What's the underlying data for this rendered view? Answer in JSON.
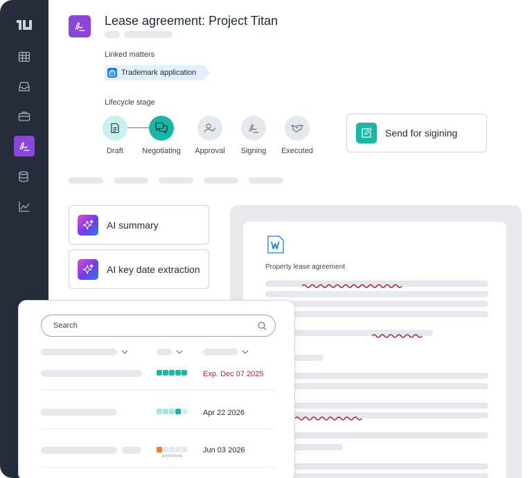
{
  "document": {
    "title": "Lease agreement: Project Titan",
    "linked_matters_label": "Linked matters",
    "linked_matter": "Trademark application",
    "lifecycle_label": "Lifecycle stage",
    "stages": [
      {
        "label": "Draft",
        "status": "completed"
      },
      {
        "label": "Negotiating",
        "status": "current"
      },
      {
        "label": "Approval",
        "status": "pending"
      },
      {
        "label": "Signing",
        "status": "pending"
      },
      {
        "label": "Executed",
        "status": "pending"
      }
    ],
    "send_button": "Send for sigining"
  },
  "ai_tools": {
    "summary": "AI summary",
    "key_date_extraction": "AI key date extraction"
  },
  "preview": {
    "file_title": "Property lease agreement",
    "file_icon": "word-doc-icon"
  },
  "table": {
    "search_placeholder": "Search",
    "rows": [
      {
        "date": "Exp.  Dec 07 2025",
        "progress": 5,
        "total": 5,
        "date_color": "#c62828"
      },
      {
        "date": "Apr 22 2026",
        "progress": 4,
        "total": 5,
        "date_color": "#1f2937"
      },
      {
        "date": "Jun  03 2026",
        "progress": 1,
        "total": 5,
        "badge": "APPROVAL",
        "date_color": "#1f2937"
      }
    ]
  },
  "colors": {
    "sidebar": "#252c3a",
    "accent_purple": "#8b46d9",
    "accent_teal": "#17b8a6",
    "link_chip": "#e3f0fb",
    "expired_red": "#c62828",
    "progress_orange": "#f07c2c"
  }
}
